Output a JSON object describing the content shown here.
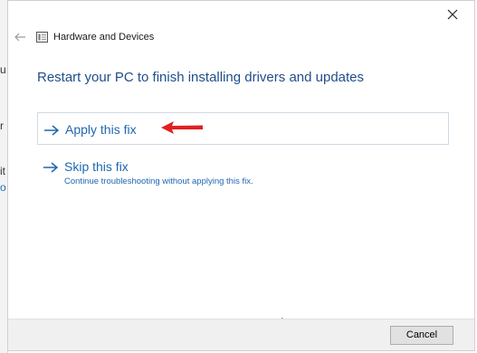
{
  "background_window": {
    "fragments": [
      "u",
      "r",
      "it",
      "o"
    ]
  },
  "titlebar": {
    "close_icon": "close-icon"
  },
  "nav": {
    "back_icon": "back-arrow-icon",
    "app_icon": "hardware-devices-icon",
    "title": "Hardware and Devices"
  },
  "main": {
    "heading": "Restart your PC to finish installing drivers and updates",
    "options": [
      {
        "label": "Apply this fix",
        "icon": "arrow-right-icon"
      },
      {
        "label": "Skip this fix",
        "description": "Continue troubleshooting without applying this fix.",
        "icon": "arrow-right-icon"
      }
    ]
  },
  "annotation": {
    "icon": "red-arrow-icon",
    "color": "#e02020"
  },
  "footer": {
    "cancel_label": "Cancel"
  },
  "colors": {
    "link_blue": "#1f67b1",
    "heading_blue": "#1f4e8a"
  }
}
